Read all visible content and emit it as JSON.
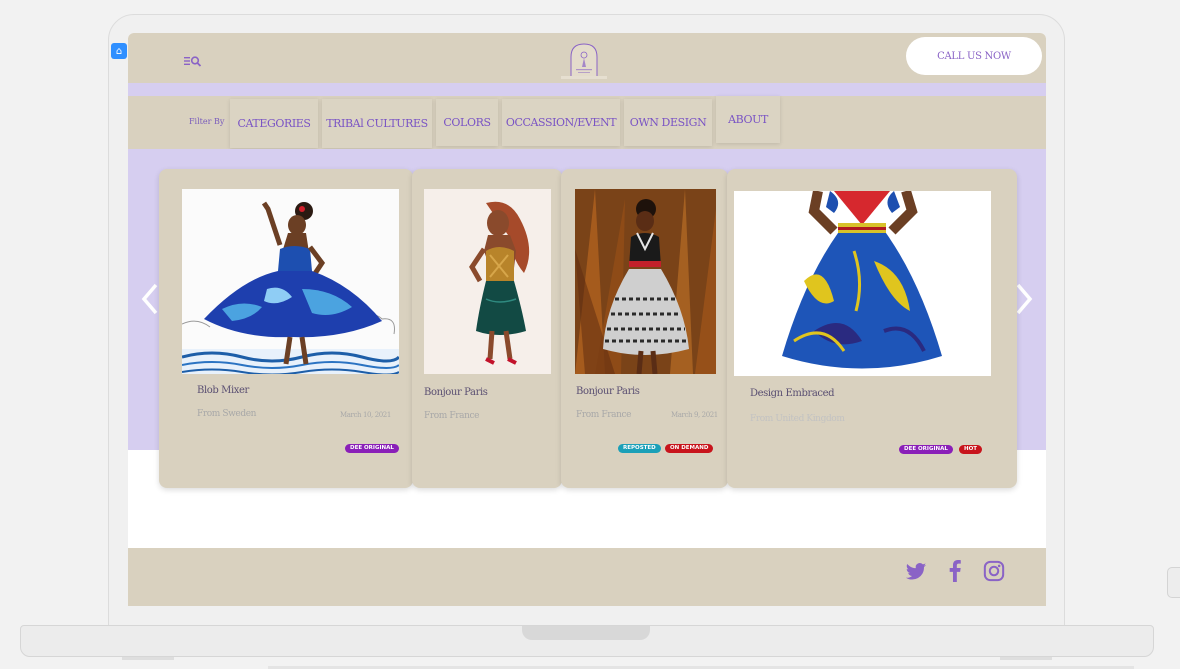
{
  "header": {
    "call_label": "CALL US NOW"
  },
  "filterbar": {
    "label": "Filter By",
    "tabs": [
      {
        "label": "CATEGORIES"
      },
      {
        "label": "TRIBAl CULTURES"
      },
      {
        "label": "COLORS"
      },
      {
        "label": "OCCASSION/EVENT"
      },
      {
        "label": "OWN DESIGN"
      },
      {
        "label": "ABOUT"
      }
    ]
  },
  "carousel": {
    "prev_icon": "chevron-left-icon",
    "next_icon": "chevron-right-icon",
    "cards": [
      {
        "title": "Blob Mixer",
        "origin": "From Sweden",
        "date": "March 10, 2021",
        "badges": [
          {
            "label": "DEE ORIGINAL",
            "color": "#8a1fb8"
          }
        ]
      },
      {
        "title": "Bonjour Paris",
        "origin": "From France",
        "date": "",
        "badges": []
      },
      {
        "title": "Bonjour Paris",
        "origin": "From France",
        "date": "March 9, 2021",
        "badges": [
          {
            "label": "REPOSTED",
            "color": "#1ba0b8"
          },
          {
            "label": "ON DEMAND",
            "color": "#c8141c"
          }
        ]
      },
      {
        "title": "Design Embraced",
        "origin": "From United Kingdom",
        "date": "",
        "badges": [
          {
            "label": "DEE ORIGINAL",
            "color": "#8a1fb8"
          },
          {
            "label": "HOT",
            "color": "#c8141c"
          }
        ]
      }
    ]
  },
  "footer": {
    "icons": [
      "twitter-icon",
      "facebook-icon",
      "instagram-icon"
    ],
    "icon_color": "#8a63c6"
  },
  "colors": {
    "accent": "#8a63c6",
    "beige": "#d9d1bf",
    "lavender": "#d6cef0"
  }
}
